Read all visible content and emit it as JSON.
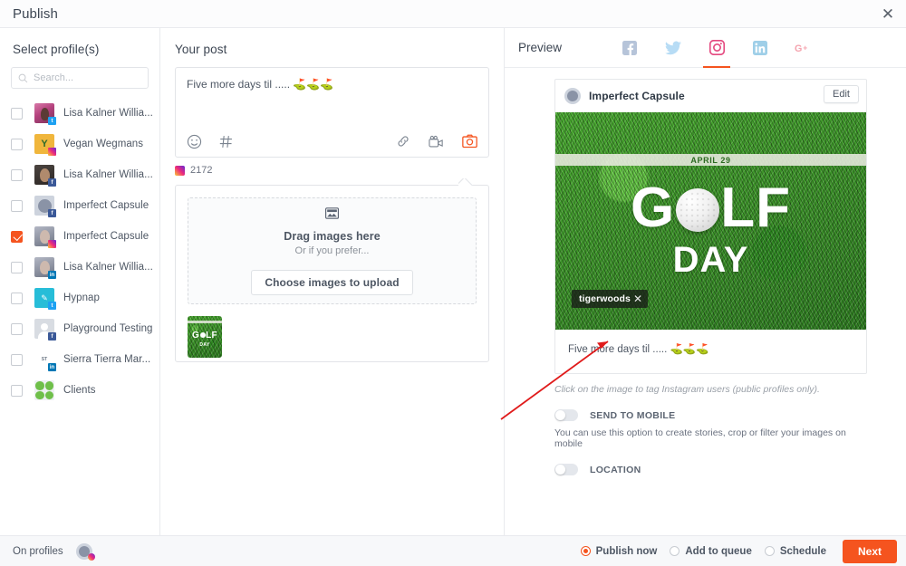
{
  "window": {
    "title": "Publish",
    "close_icon": "close-icon"
  },
  "profiles_panel": {
    "heading": "Select profile(s)",
    "search": {
      "placeholder": "Search...",
      "value": "",
      "icon": "search-icon"
    },
    "items": [
      {
        "name": "Lisa Kalner Willia...",
        "network": "twitter",
        "checked": false
      },
      {
        "name": "Vegan Wegmans",
        "network": "instagram",
        "checked": false
      },
      {
        "name": "Lisa Kalner Willia...",
        "network": "facebook",
        "checked": false
      },
      {
        "name": "Imperfect Capsule",
        "network": "facebook",
        "checked": false
      },
      {
        "name": "Imperfect Capsule",
        "network": "instagram",
        "checked": true
      },
      {
        "name": "Lisa Kalner Willia...",
        "network": "linkedin",
        "checked": false
      },
      {
        "name": "Hypnap",
        "network": "twitter",
        "checked": false
      },
      {
        "name": "Playground Testing",
        "network": "facebook",
        "checked": false
      },
      {
        "name": "Sierra Tierra Mar...",
        "network": "linkedin",
        "checked": false
      },
      {
        "name": "Clients",
        "network": "none",
        "checked": false
      }
    ]
  },
  "post_panel": {
    "heading": "Your post",
    "compose_text": "Five more days til ..... ⛳⛳⛳",
    "compose_placeholder": "",
    "toolbar_left": [
      "emoji-icon",
      "hashtag-icon"
    ],
    "toolbar_right": [
      "link-icon",
      "video-icon",
      "image-icon"
    ],
    "char_counter": "2172",
    "counter_network": "instagram",
    "dropzone": {
      "icon": "image-placeholder-icon",
      "title": "Drag images here",
      "subtitle": "Or if you prefer...",
      "button": "Choose images to upload"
    },
    "attachment": {
      "label_top": "G LF",
      "label_bottom": "DAY"
    }
  },
  "preview_panel": {
    "heading": "Preview",
    "tabs": [
      {
        "network": "facebook",
        "icon": "facebook-icon",
        "active": false
      },
      {
        "network": "twitter",
        "icon": "twitter-icon",
        "active": false
      },
      {
        "network": "instagram",
        "icon": "instagram-icon",
        "active": true
      },
      {
        "network": "linkedin",
        "icon": "linkedin-icon",
        "active": false
      },
      {
        "network": "googleplus",
        "icon": "google-plus-icon",
        "active": false
      }
    ],
    "card": {
      "account_name": "Imperfect Capsule",
      "edit_button": "Edit",
      "image": {
        "date_band": "APRIL 29",
        "headline": "G LF",
        "subline": "DAY",
        "tag": {
          "name": "tigerwoods",
          "remove_icon": "close-icon"
        }
      },
      "caption": "Five more days til ..... ⛳⛳⛳"
    },
    "hint": "Click on the image to tag Instagram users (public profiles only).",
    "options": [
      {
        "label": "SEND TO MOBILE",
        "on": false,
        "description": "You can use this option to create stories, crop or filter your images on mobile"
      },
      {
        "label": "LOCATION",
        "on": false,
        "description": ""
      }
    ]
  },
  "footer": {
    "on_profiles_label": "On profiles",
    "selected_network": "instagram",
    "radios": [
      {
        "label": "Publish now",
        "selected": true
      },
      {
        "label": "Add to queue",
        "selected": false
      },
      {
        "label": "Schedule",
        "selected": false
      }
    ],
    "next_button": "Next"
  },
  "colors": {
    "accent": "#f5541f",
    "text": "#4e5764",
    "border": "#e9eaee",
    "grass": "#3f9e2c",
    "annotation": "#e01b1b"
  }
}
